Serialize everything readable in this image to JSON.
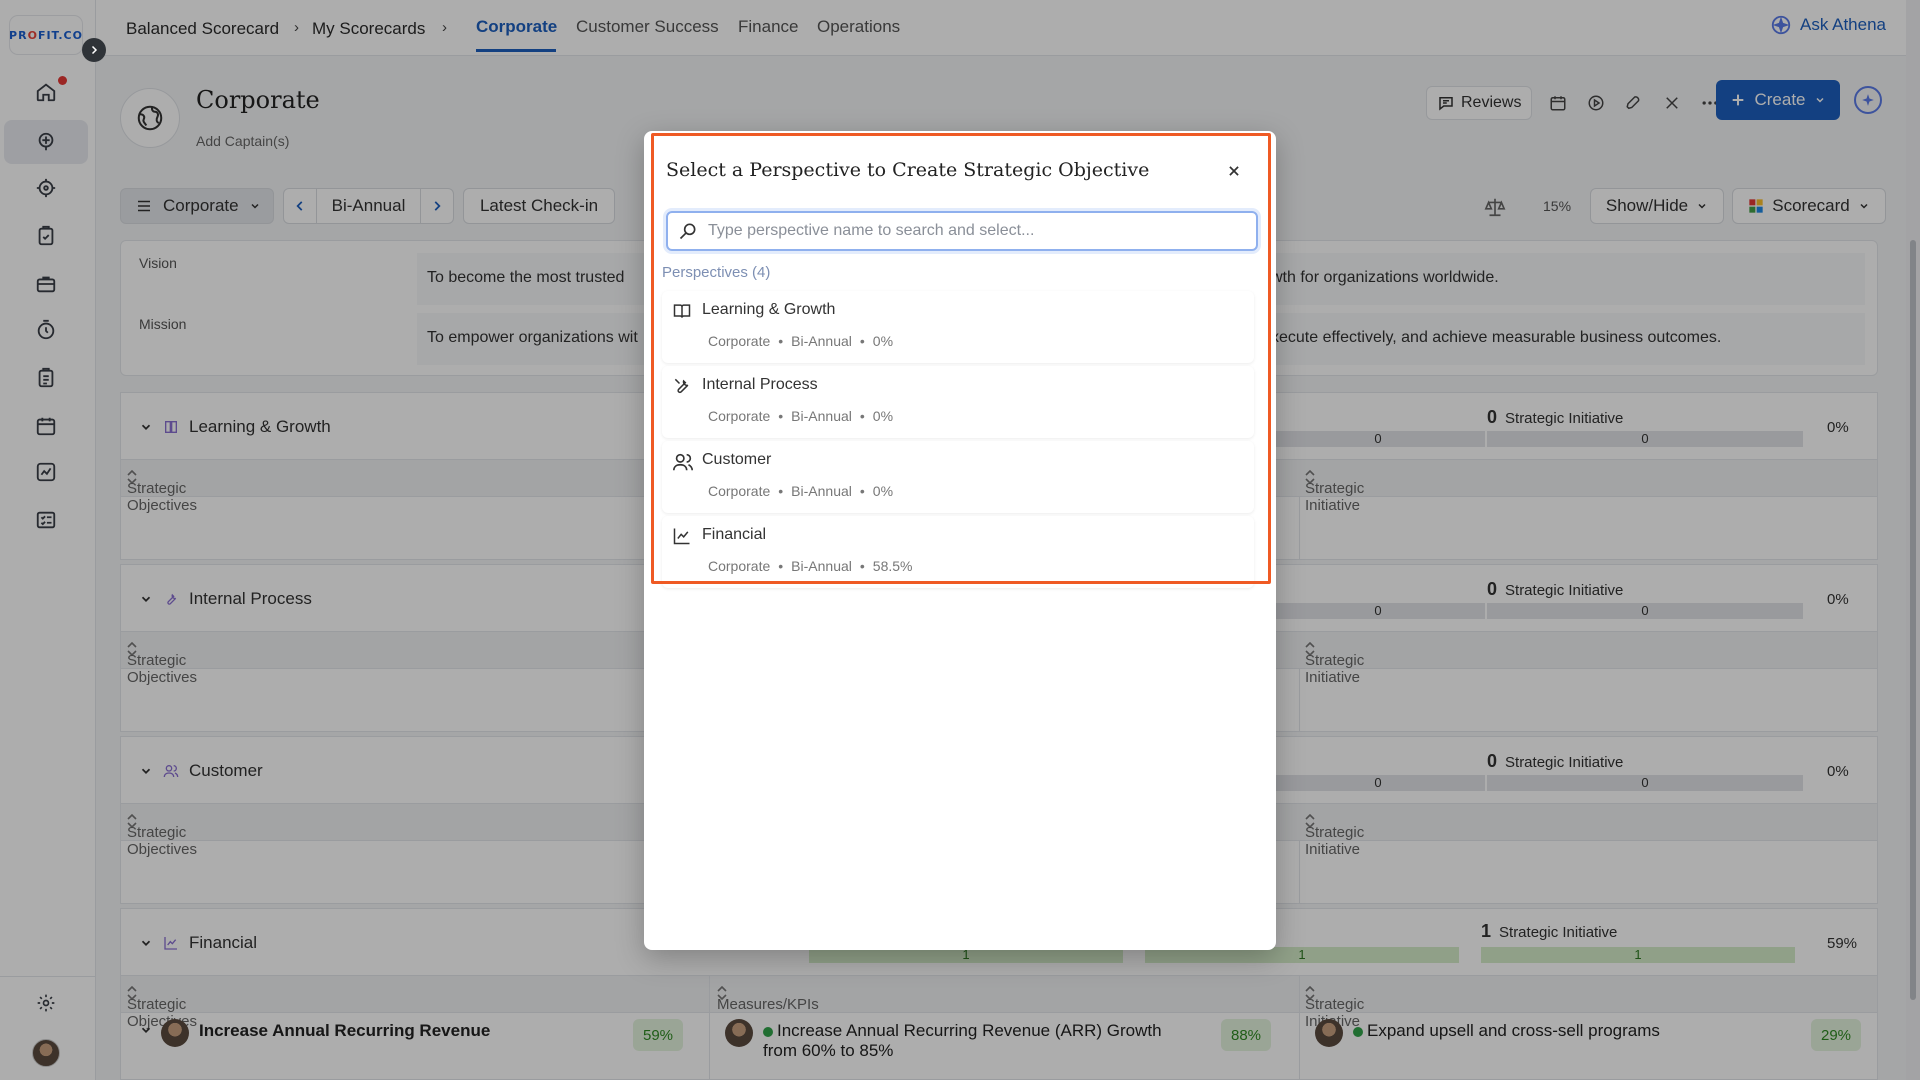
{
  "app": {
    "logo_text_1": "PR",
    "logo_text_2": "O",
    "logo_text_3": "FIT.CO"
  },
  "topbar": {
    "breadcrumb": [
      "Balanced Scorecard",
      "My Scorecards"
    ],
    "breadcrumb_sep": "›",
    "tabs": [
      "Corporate",
      "Customer Success",
      "Finance",
      "Operations"
    ],
    "ask_label": "Ask Athena"
  },
  "header": {
    "title": "Corporate",
    "add_captains": "Add Captain(s)",
    "reviews_label": "Reviews",
    "create_label": "Create"
  },
  "toolbar": {
    "scorecard_select": "Corporate",
    "period": "Bi-Annual",
    "checkin": "Latest Check-in",
    "weight_pct": "15%",
    "show_hide": "Show/Hide",
    "view": "Scorecard"
  },
  "vision_mission": {
    "vision_label": "Vision",
    "vision_text_left": "To become the most trusted",
    "vision_text_right": "wth for organizations worldwide.",
    "mission_label": "Mission",
    "mission_text_left": "To empower organizations wit",
    "mission_text_right": "xecute effectively, and achieve measurable business outcomes."
  },
  "columns": {
    "objectives": "Strategic Objectives",
    "measures": "Measures/KPIs",
    "initiatives": "Strategic Initiative"
  },
  "sections": [
    {
      "name": "Learning & Growth",
      "si_count": "0",
      "si_label": "Strategic Initiative",
      "bar_mid": "0",
      "bar_right": "0",
      "pct": "0%"
    },
    {
      "name": "Internal Process",
      "si_count": "0",
      "si_label": "Strategic Initiative",
      "bar_mid": "0",
      "bar_right": "0",
      "pct": "0%"
    },
    {
      "name": "Customer",
      "si_count": "0",
      "si_label": "Strategic Initiative",
      "bar_mid": "0",
      "bar_right": "0",
      "pct": "0%"
    },
    {
      "name": "Financial",
      "si_count": "1",
      "si_label": "Strategic Initiative",
      "bar_left": "1",
      "bar_mid": "1",
      "bar_right": "1",
      "pct": "59%"
    }
  ],
  "financial_row": {
    "objective": "Increase Annual Recurring Revenue",
    "objective_pct": "59%",
    "measure": "Increase Annual Recurring Revenue (ARR) Growth from 60% to 85%",
    "measure_pct": "88%",
    "initiative": "Expand upsell and cross-sell programs",
    "initiative_pct": "29%"
  },
  "modal": {
    "title": "Select a Perspective to Create Strategic Objective",
    "search_placeholder": "Type perspective name to search and select...",
    "search_value": "",
    "count_label": "Perspectives (4)",
    "meta_sep": "•",
    "options": [
      {
        "name": "Learning & Growth",
        "scorecard": "Corporate",
        "period": "Bi-Annual",
        "pct": "0%",
        "icon": "book-icon"
      },
      {
        "name": "Internal Process",
        "scorecard": "Corporate",
        "period": "Bi-Annual",
        "pct": "0%",
        "icon": "wrench-icon"
      },
      {
        "name": "Customer",
        "scorecard": "Corporate",
        "period": "Bi-Annual",
        "pct": "0%",
        "icon": "users-icon"
      },
      {
        "name": "Financial",
        "scorecard": "Corporate",
        "period": "Bi-Annual",
        "pct": "58.5%",
        "icon": "chart-line-icon"
      }
    ]
  },
  "colors": {
    "accent": "#1c5fbf",
    "highlight": "#ef5a24",
    "success": "#31a34a"
  }
}
